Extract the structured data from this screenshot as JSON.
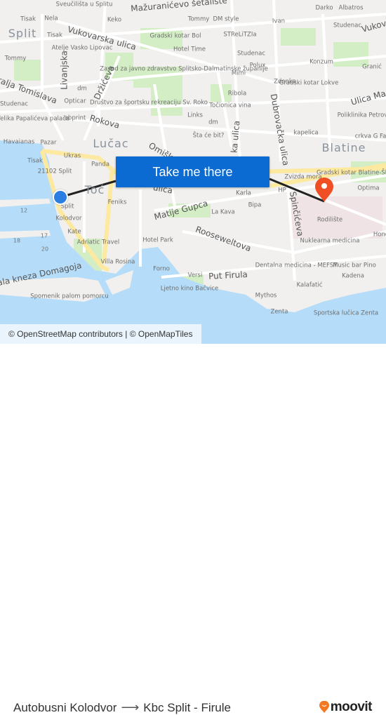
{
  "map": {
    "colors": {
      "land": "#f1f0ee",
      "water": "#b5dcf8",
      "park": "#d3eec5",
      "major_road": "#fde9a0",
      "route": "#222222",
      "button": "#0b6bd3",
      "origin": "#2a7de1",
      "destination": "#f04e23"
    },
    "labels": [
      "Sveučilišta u Splitu",
      "Mažuranićevo šetalište",
      "Darko",
      "Albatros",
      "Nela",
      "Tisak",
      "Keko",
      "Tommy",
      "DM style",
      "Ivan",
      "Studenac",
      "Split",
      "Tisak",
      "Vukovarska ulica",
      "Gradski kotar Bol",
      "STReLiTZIa",
      "Vukov",
      "Atelje Vasko Lipovac",
      "Hotel Time",
      "Studenac",
      "Tommy",
      "Zavod za javno zdravstvo Splitsko-Dalmatinske županije",
      "Polux",
      "Konzum",
      "Granić",
      "Mimi",
      "Livanjska",
      "Držićeva",
      "Kralja Tomislava",
      "dm",
      "Zdenka",
      "Gradski kotar Lokve",
      "Studenac",
      "Opticar",
      "Društvo za športsku rekreaciju Sv. Roko",
      "Ribola",
      "Točionica vina",
      "Ulica Ma",
      "Velika Papalićeva palača",
      "abprint",
      "Rokova",
      "Links",
      "Poliklinika Petrović",
      "dm",
      "Šta će bit?",
      "kapelica",
      "crkva G Fatim",
      "Havaianas",
      "Pazar",
      "Lučac",
      "Omiška",
      "Blatine",
      "Dubrovačka ulica",
      "ka ulica",
      "Ukras",
      "Tisak",
      "Panda",
      "21102 Split",
      "Gradski kotar Blatine-Škrape",
      "Zvizda mora",
      "Optima",
      "Split",
      "Karla",
      "HP",
      "Toć",
      "ulica",
      "Feniks",
      "12",
      "Bipa",
      "Matije Gupca",
      "La Kava",
      "Kolodvor",
      "Spinčićeva",
      "Rodilište",
      "Kate",
      "Hond",
      "17",
      "18",
      "Adriatic Travel",
      "Hotel Park",
      "Rooseweltova",
      "Nuklearna medicina",
      "20",
      "Villa Rosina",
      "Obala kneza Domagoja",
      "Forno",
      "Dentalna medicina - MEFST",
      "Music bar Pino",
      "Versi",
      "Put Firula",
      "Kadena",
      "Ljetno kino Bačvice",
      "Kalafatić",
      "Spomenik palom pomorcu",
      "Mythos",
      "Zenta",
      "Sportska lučica Zenta"
    ],
    "attribution": "© OpenStreetMap contributors | © OpenMapTiles",
    "cta_label": "Take me there",
    "origin_icon": "origin-dot-icon",
    "destination_icon": "destination-pin-icon"
  },
  "footer": {
    "from": "Autobusni Kolodvor",
    "arrow_icon": "arrow-right-icon",
    "to": "Kbc Split - Firule",
    "logo_text": "moovit"
  }
}
